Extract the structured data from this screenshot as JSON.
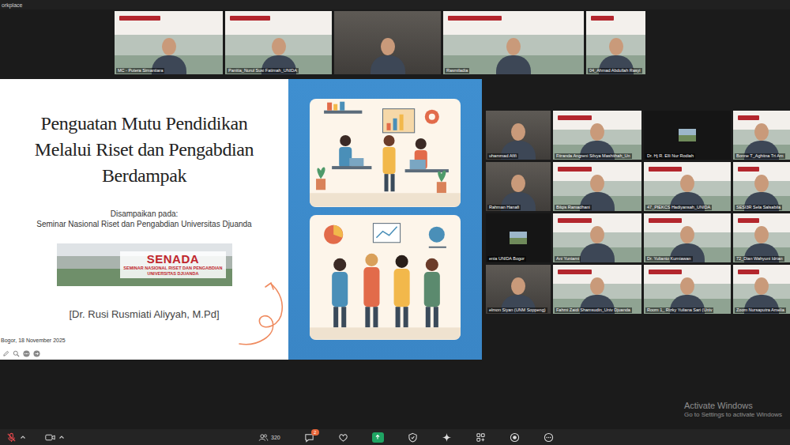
{
  "browser_tab": {
    "title": "orkplace"
  },
  "speakers": [
    {
      "name": "MC - Putera Simantiara",
      "kind": "branded"
    },
    {
      "name": "Panitia_Nurul Susi Fatimah_UNIDA",
      "kind": "branded"
    },
    {
      "kind": "plain"
    },
    {
      "name": "Rasmiladia",
      "kind": "branded"
    },
    {
      "name": "04_Ahmad Abdullah Rasyi",
      "kind": "branded"
    }
  ],
  "slide": {
    "title_lines": [
      "Penguatan Mutu Pendidikan",
      "Melalui Riset dan Pengabdian",
      "Berdampak"
    ],
    "delivered_label": "Disampaikan pada:",
    "event": "Seminar Nasional Riset dan Pengabdian Universitas Djuanda",
    "logo": {
      "title": "SENADA",
      "subtitle_lines": [
        "SEMINAR NASIONAL RISET DAN PENGABDIAN",
        "UNIVERSITAS DJUANDA"
      ]
    },
    "presenter": "[Dr. Rusi Rusmiati Aliyyah, M.Pd]",
    "date": "Bogor, 18 November 2025"
  },
  "gallery": [
    {
      "name": "uhammad Afifi",
      "kind": "plain"
    },
    {
      "name": "Fitranda Angreni Silvya Mashithah_Un",
      "kind": "branded"
    },
    {
      "name": "Dr. Hj R. Elli Nur Rodiah",
      "kind": "avatar"
    },
    {
      "name": "Bonne T_Aghitna Tri Am",
      "kind": "branded"
    },
    {
      "name": "Rahman Hanafi",
      "kind": "plain"
    },
    {
      "name": "Bilqis Ramadhani",
      "kind": "branded"
    },
    {
      "name": "47_PIEKCS Hadiyansah_UNIDA",
      "kind": "branded"
    },
    {
      "name": "SESI3R Sela Salsabila",
      "kind": "branded"
    },
    {
      "name": "enia UNIDA Bogor",
      "kind": "avatar"
    },
    {
      "name": "Ani Yuniarni",
      "kind": "branded"
    },
    {
      "name": "Dr. Yulianto Kurniawan",
      "kind": "branded"
    },
    {
      "name": "72_Dian Wahyuni Idrian",
      "kind": "branded"
    },
    {
      "name": "elmon Siyan (UNM Soppeng)",
      "kind": "plain"
    },
    {
      "name": "Fahmi Zaidi Shamsudin_Univ Djuanda",
      "kind": "branded"
    },
    {
      "name": "Room 1_ Rizky Yuliana Sari (Univ",
      "kind": "branded"
    },
    {
      "name": "Zoom Nursaputra Amelia",
      "kind": "branded"
    }
  ],
  "toolbar": {
    "mic_muted": true,
    "participants_count": "320",
    "chat_badge": "2",
    "sharing": true
  },
  "watermark": {
    "title": "Activate Windows",
    "subtitle": "Go to Settings to activate Windows"
  }
}
